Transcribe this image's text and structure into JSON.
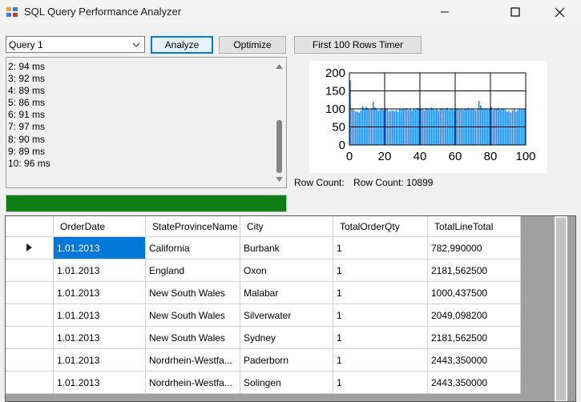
{
  "window": {
    "title": "SQL Query Performance Analyzer"
  },
  "toolbar": {
    "query_select": "Query 1",
    "analyze_label": "Analyze",
    "optimize_label": "Optimize",
    "timer_label": "First 100 Rows Timer"
  },
  "log": {
    "lines": [
      "2: 94 ms",
      "3: 92 ms",
      "4: 89 ms",
      "5: 86 ms",
      "6: 91 ms",
      "7: 97 ms",
      "8: 90 ms",
      "9: 89 ms",
      "10: 96 ms"
    ]
  },
  "progress": {
    "value_percent": 100,
    "color": "#0f7f15"
  },
  "row_count": {
    "label": "Row Count:",
    "value": "Row Count: 10899"
  },
  "chart_data": {
    "type": "bar",
    "xlim": [
      0,
      100
    ],
    "ylim": [
      0,
      200
    ],
    "x_ticks": [
      "0",
      "20",
      "40",
      "60",
      "80",
      "100"
    ],
    "y_ticks": [
      "0",
      "50",
      "100",
      "150",
      "200"
    ],
    "grid": true,
    "bar_color": "#1e90ff",
    "values": [
      180,
      100,
      97,
      93,
      92,
      90,
      95,
      108,
      100,
      105,
      103,
      98,
      102,
      120,
      105,
      100,
      95,
      98,
      102,
      96,
      101,
      100,
      93,
      95,
      96,
      94,
      97,
      92,
      100,
      98,
      99,
      100,
      102,
      97,
      101,
      95,
      100,
      98,
      103,
      100,
      99,
      101,
      96,
      102,
      100,
      98,
      104,
      100,
      97,
      101,
      95,
      99,
      102,
      98,
      100,
      103,
      97,
      101,
      99,
      96,
      100,
      102,
      98,
      101,
      97,
      100,
      99,
      103,
      98,
      100,
      101,
      96,
      98,
      122,
      110,
      100,
      99,
      102,
      98,
      101,
      105,
      97,
      100,
      99,
      103,
      98,
      101,
      100,
      97,
      92,
      95,
      90,
      96,
      99,
      93,
      97,
      100,
      98,
      101,
      100
    ]
  },
  "table": {
    "columns": [
      "OrderDate",
      "StateProvinceName",
      "City",
      "TotalOrderQty",
      "TotalLineTotal"
    ],
    "rows": [
      [
        "1.01.2013",
        "California",
        "Burbank",
        "1",
        "782,990000"
      ],
      [
        "1.01.2013",
        "England",
        "Oxon",
        "1",
        "2181,562500"
      ],
      [
        "1.01.2013",
        "New South Wales",
        "Malabar",
        "1",
        "1000,437500"
      ],
      [
        "1.01.2013",
        "New South Wales",
        "Silverwater",
        "1",
        "2049,098200"
      ],
      [
        "1.01.2013",
        "New South Wales",
        "Sydney",
        "1",
        "2181,562500"
      ],
      [
        "1.01.2013",
        "Nordrhein-Westfa...",
        "Paderborn",
        "1",
        "2443,350000"
      ],
      [
        "1.01.2013",
        "Nordrhein-Westfa...",
        "Solingen",
        "1",
        "2443,350000"
      ]
    ]
  },
  "icons": {
    "app": "app-icon",
    "minimize": "minimize-icon",
    "maximize": "maximize-icon",
    "close": "close-icon",
    "dropdown": "chevron-down-icon",
    "current_row": "row-pointer-icon"
  }
}
